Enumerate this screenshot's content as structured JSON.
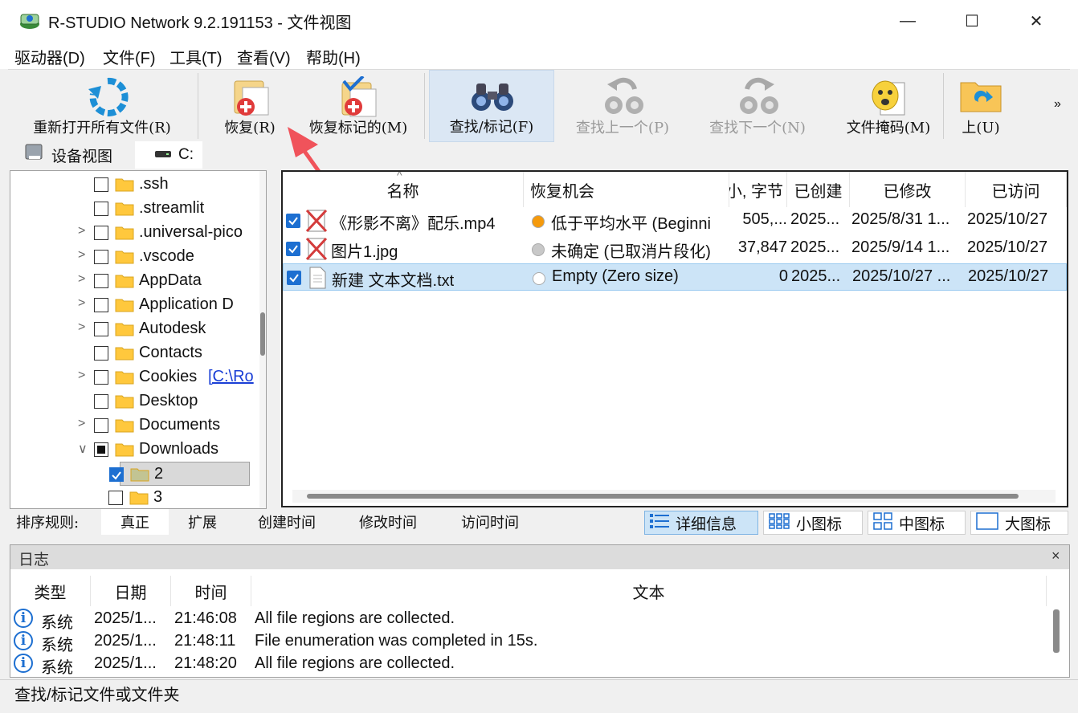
{
  "window": {
    "title": "R-STUDIO Network 9.2.191153 - 文件视图",
    "controls": {
      "minimize": "—",
      "maximize": "☐",
      "close": "✕"
    }
  },
  "menu": [
    "驱动器(D)",
    "文件(F)",
    "工具(T)",
    "查看(V)",
    "帮助(H)"
  ],
  "toolbar": {
    "buttons": [
      {
        "label": "重新打开所有文件(R)",
        "icon": "refresh-icon",
        "enabled": true,
        "active": false
      },
      {
        "label": "恢复(R)",
        "icon": "recover-folder-icon",
        "enabled": true,
        "active": false
      },
      {
        "label": "恢复标记的(M)",
        "icon": "recover-marked-icon",
        "enabled": true,
        "active": false
      },
      {
        "label": "查找/标记(F)",
        "icon": "binoculars-icon",
        "enabled": true,
        "active": true
      },
      {
        "label": "查找上一个(P)",
        "icon": "find-previous-icon",
        "enabled": false,
        "active": false
      },
      {
        "label": "查找下一个(N)",
        "icon": "find-next-icon",
        "enabled": false,
        "active": false
      },
      {
        "label": "文件掩码(M)",
        "icon": "file-mask-icon",
        "enabled": true,
        "active": false
      },
      {
        "label": "上(U)",
        "icon": "up-folder-icon",
        "enabled": true,
        "active": false
      }
    ],
    "overflow": "»"
  },
  "view_tabs": [
    {
      "label": "设备视图",
      "icon": "device-icon"
    },
    {
      "label": "C:",
      "icon": "drive-icon"
    }
  ],
  "tree": {
    "items": [
      {
        "name": ".ssh",
        "expander": "",
        "checked": "none",
        "link": ""
      },
      {
        "name": ".streamlit",
        "expander": "",
        "checked": "none",
        "link": ""
      },
      {
        "name": ".universal-pico",
        "expander": ">",
        "checked": "none",
        "link": ""
      },
      {
        "name": ".vscode",
        "expander": ">",
        "checked": "none",
        "link": ""
      },
      {
        "name": "AppData",
        "expander": ">",
        "checked": "none",
        "link": ""
      },
      {
        "name": "Application D",
        "expander": ">",
        "checked": "none",
        "link": ""
      },
      {
        "name": "Autodesk",
        "expander": ">",
        "checked": "none",
        "link": ""
      },
      {
        "name": "Contacts",
        "expander": "",
        "checked": "none",
        "link": ""
      },
      {
        "name": "Cookies",
        "expander": ">",
        "checked": "none",
        "link": "[C:\\Ro"
      },
      {
        "name": "Desktop",
        "expander": "",
        "checked": "none",
        "link": ""
      },
      {
        "name": "Documents",
        "expander": ">",
        "checked": "none",
        "link": ""
      },
      {
        "name": "Downloads",
        "expander": "∨",
        "checked": "partial",
        "link": ""
      },
      {
        "name": "2",
        "expander": "",
        "checked": "checked",
        "link": ""
      },
      {
        "name": "3",
        "expander": "",
        "checked": "none",
        "link": ""
      }
    ]
  },
  "filelist": {
    "columns": [
      "名称",
      "恢复机会",
      "大小, 字节",
      "已创建",
      "已修改",
      "已访问"
    ],
    "sort_indicator": "^",
    "rows": [
      {
        "name": "《形影不离》配乐.mp4",
        "chance": "低于平均水平 (Beginni",
        "chance_color": "#f59a0c",
        "size": "505,...",
        "created": "2025...",
        "modified": "2025/8/31 1...",
        "accessed": "2025/10/27"
      },
      {
        "name": "图片1.jpg",
        "chance": "未确定 (已取消片段化)",
        "chance_color": "#c8c8c8",
        "size": "37,847",
        "created": "2025...",
        "modified": "2025/9/14 1...",
        "accessed": "2025/10/27"
      },
      {
        "name": "新建 文本文档.txt",
        "chance": "Empty (Zero size)",
        "chance_color": "#ffffff",
        "size": "0",
        "created": "2025...",
        "modified": "2025/10/27 ...",
        "accessed": "2025/10/27"
      }
    ]
  },
  "sortbar": {
    "label": "排序规则:",
    "items": [
      "真正",
      "扩展",
      "创建时间",
      "修改时间",
      "访问时间"
    ],
    "views": [
      {
        "label": "详细信息",
        "icon": "details-view-icon",
        "active": true
      },
      {
        "label": "小图标",
        "icon": "small-icons-icon",
        "active": false
      },
      {
        "label": "中图标",
        "icon": "medium-icons-icon",
        "active": false
      },
      {
        "label": "大图标",
        "icon": "large-icons-icon",
        "active": false
      }
    ]
  },
  "log": {
    "title": "日志",
    "close": "×",
    "columns": [
      "类型",
      "日期",
      "时间",
      "文本"
    ],
    "rows": [
      {
        "type": "系统",
        "date": "2025/1...",
        "time": "21:46:08",
        "text": "All file regions are collected."
      },
      {
        "type": "系统",
        "date": "2025/1...",
        "time": "21:48:11",
        "text": "File enumeration was completed in 15s."
      },
      {
        "type": "系统",
        "date": "2025/1...",
        "time": "21:48:20",
        "text": "All file regions are collected."
      }
    ]
  },
  "status": {
    "text": "查找/标记文件或文件夹"
  },
  "colors": {
    "accent": "#1d6fd1",
    "selection": "#cce4f7",
    "annotation_arrow": "#f0535b",
    "folder": "#ffc83d"
  }
}
